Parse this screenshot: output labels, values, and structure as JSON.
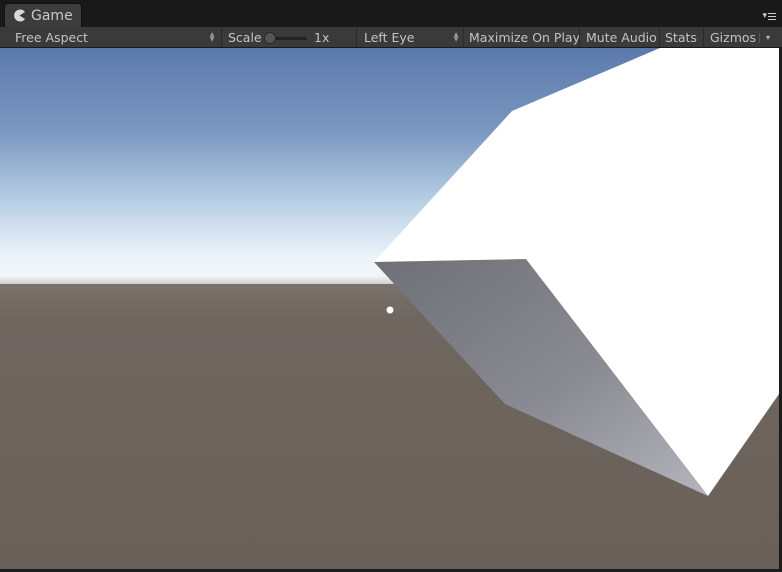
{
  "tab": {
    "title": "Game",
    "icon": "pacman-game-icon"
  },
  "toolbar": {
    "aspect": "Free Aspect",
    "scale_label": "Scale",
    "scale_value": "1x",
    "eye": "Left Eye",
    "maximize": "Maximize On Play",
    "mute": "Mute Audio",
    "stats": "Stats",
    "gizmos": "Gizmos",
    "scale_fraction": 0.0
  },
  "colors": {
    "toolbar_bg": "#3a3a3a",
    "tab_bg": "#3c3c3c",
    "sky_top": "#5d7bad",
    "horizon": "#f1f6fb",
    "ground": "#6e6560",
    "cube_top": "#ffffff",
    "cube_side": "#8d8d95"
  }
}
